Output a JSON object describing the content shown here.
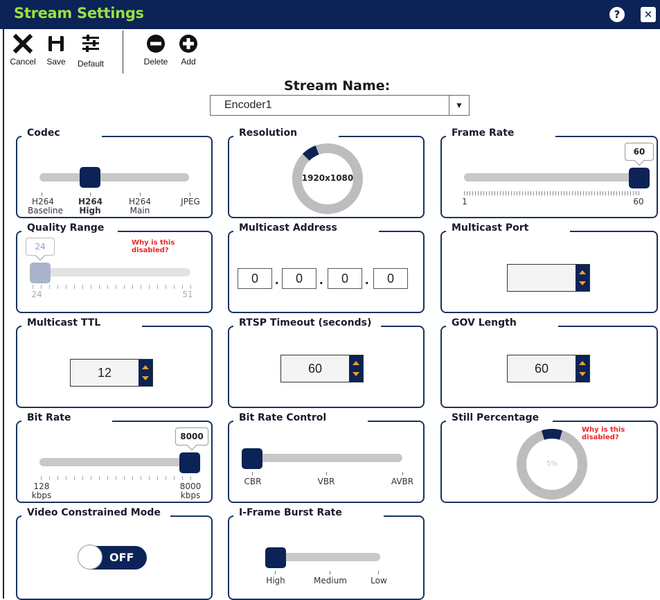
{
  "window": {
    "title": "Stream Settings",
    "help_glyph": "?",
    "close_glyph": "✕"
  },
  "toolbar": {
    "cancel": "Cancel",
    "save": "Save",
    "default": "Default",
    "delete": "Delete",
    "add": "Add"
  },
  "stream": {
    "label": "Stream Name:",
    "selected": "Encoder1"
  },
  "codec": {
    "title": "Codec",
    "options": [
      {
        "line1": "H264",
        "line2": "Baseline"
      },
      {
        "line1": "H264",
        "line2": "High"
      },
      {
        "line1": "H264",
        "line2": "Main"
      },
      {
        "line1": "JPEG",
        "line2": ""
      }
    ],
    "selected_index": 1
  },
  "resolution": {
    "title": "Resolution",
    "value": "1920x1080"
  },
  "frame_rate": {
    "title": "Frame Rate",
    "value": "60",
    "min": "1",
    "max": "60"
  },
  "quality_range": {
    "title": "Quality Range",
    "warning": "Why is this disabled?",
    "value": "24",
    "min": "24",
    "max": "51"
  },
  "multicast_address": {
    "title": "Multicast Address",
    "octets": [
      "0",
      "0",
      "0",
      "0"
    ]
  },
  "multicast_port": {
    "title": "Multicast Port",
    "value": ""
  },
  "multicast_ttl": {
    "title": "Multicast TTL",
    "value": "12"
  },
  "rtsp_timeout": {
    "title": "RTSP Timeout (seconds)",
    "value": "60"
  },
  "gov_length": {
    "title": "GOV Length",
    "value": "60"
  },
  "bit_rate": {
    "title": "Bit Rate",
    "value": "8000",
    "min": "128",
    "max": "8000",
    "unit": "kbps"
  },
  "bit_rate_control": {
    "title": "Bit Rate Control",
    "options": [
      "CBR",
      "VBR",
      "AVBR"
    ],
    "selected_index": 0
  },
  "still_percentage": {
    "title": "Still Percentage",
    "warning": "Why is this disabled?",
    "value": "5%"
  },
  "video_constrained_mode": {
    "title": "Video Constrained Mode",
    "state": "OFF"
  },
  "iframe_burst_rate": {
    "title": "I-Frame Burst Rate",
    "options": [
      "High",
      "Medium",
      "Low"
    ],
    "selected_index": 0
  },
  "colors": {
    "navy": "#0b2356",
    "title_green": "#9be03a",
    "warning_red": "#e8262a",
    "track_gray": "#c8c8c8",
    "spinner_arrow": "#f0a020"
  }
}
